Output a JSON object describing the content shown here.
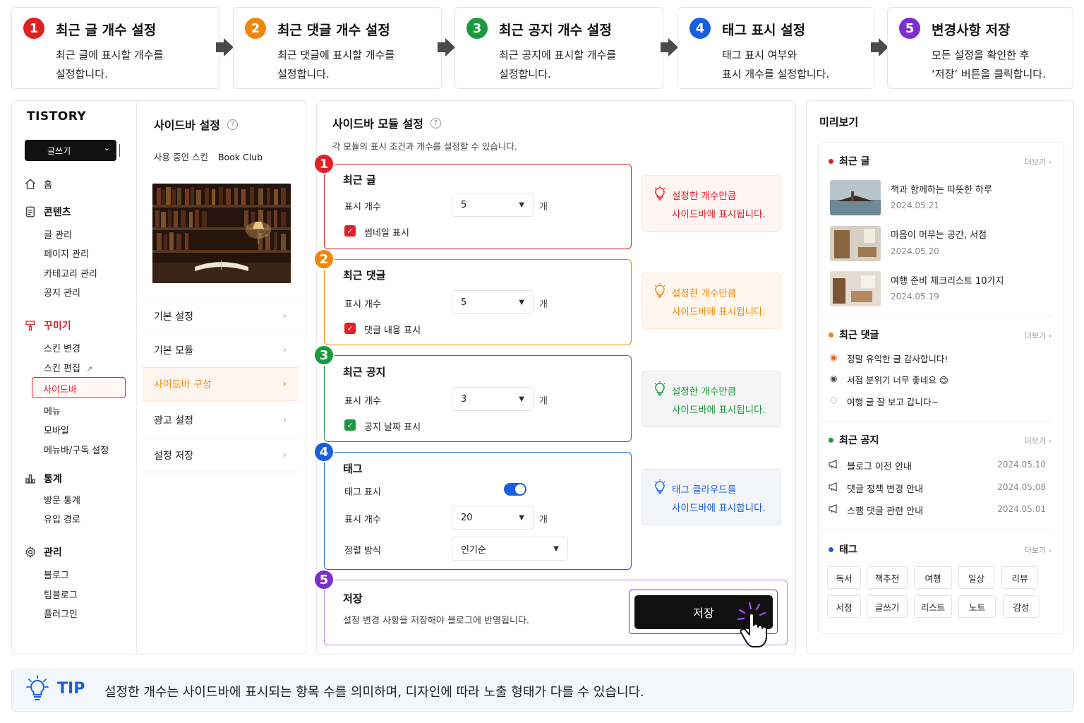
{
  "steps": [
    {
      "num": "1",
      "title": "최근 글 개수 설정",
      "desc1": "최근 글에 표시할 개수를",
      "desc2": "설정합니다.",
      "color": "#e02020"
    },
    {
      "num": "2",
      "title": "최근 댓글 개수 설정",
      "desc1": "최근 댓글에 표시할 개수를",
      "desc2": "설정합니다.",
      "color": "#f0860a"
    },
    {
      "num": "3",
      "title": "최근 공지 개수 설정",
      "desc1": "최근 공지에 표시할 개수를",
      "desc2": "설정합니다.",
      "color": "#1a9a3e"
    },
    {
      "num": "4",
      "title": "태그 표시 설정",
      "desc1": "태그 표시 여부와",
      "desc2": "표시 개수를 설정합니다.",
      "color": "#1a5fe0"
    },
    {
      "num": "5",
      "title": "변경사항 저장",
      "desc1": "모든 설정을 확인한 후",
      "desc2": "‘저장’ 버튼을 클릭합니다.",
      "color": "#7b2fd0"
    }
  ],
  "sidebar": {
    "logo": "TISTORY",
    "write": "글쓰기",
    "home": "홈",
    "content": "콘텐츠",
    "content_items": [
      "글 관리",
      "페이지 관리",
      "카테고리 관리",
      "공지 관리"
    ],
    "decorate": "꾸미기",
    "decorate_items": [
      "스킨 변경",
      "스킨 편집",
      "사이드바",
      "메뉴",
      "모바일",
      "메뉴바/구독 설정"
    ],
    "stats": "통계",
    "stats_items": [
      "방문 통계",
      "유입 경로"
    ],
    "manage": "관리",
    "manage_items": [
      "블로그",
      "팀블로그",
      "플러그인"
    ]
  },
  "settings": {
    "title": "사이드바 설정",
    "skin_label": "사용 중인 스킨",
    "skin_name": "Book Club",
    "menu": [
      "기본 설정",
      "기본 모듈",
      "사이드바 구성",
      "광고 설정",
      "설정 저장"
    ]
  },
  "modules": {
    "title": "사이드바 모듈 설정",
    "desc": "각 모듈의 표시 조건과 개수를 설정할 수 있습니다.",
    "count_label": "표시 개수",
    "unit": "개",
    "recent_posts": {
      "num": "1",
      "title": "최근 글",
      "count": "5",
      "check": "썸네일 표시"
    },
    "recent_comments": {
      "num": "2",
      "title": "최근 댓글",
      "count": "5",
      "check": "댓글 내용 표시"
    },
    "recent_notices": {
      "num": "3",
      "title": "최근 공지",
      "count": "3",
      "check": "공지 날짜 표시"
    },
    "tags": {
      "num": "4",
      "title": "태그",
      "show_label": "태그 표시",
      "count": "20",
      "sort_label": "정렬 방식",
      "sort": "인기순"
    },
    "save": {
      "num": "5",
      "title": "저장",
      "desc": "설정 변경 사항을 저장해야 블로그에 반영됩니다.",
      "button": "저장"
    }
  },
  "hints": [
    {
      "l1": "설정한 개수만큼",
      "l2": "사이드바에 표시됩니다.",
      "color": "#e0202a",
      "bg": "#fff5f3"
    },
    {
      "l1": "설정한 개수만큼",
      "l2": "사이드바에 표시됩니다.",
      "color": "#f0860a",
      "bg": "#fff7ee"
    },
    {
      "l1": "설정한 개수만큼",
      "l2": "사이드바에 표시됩니다.",
      "color": "#1a9a3e",
      "bg": "#f4f5f4"
    },
    {
      "l1": "태그 클라우드를",
      "l2": "사이드바에 표시합니다.",
      "color": "#1a5fe0",
      "bg": "#f3f5f9"
    }
  ],
  "preview": {
    "title": "미리보기",
    "more": "더보기",
    "posts_title": "최근 글",
    "posts": [
      {
        "title": "책과 함께하는 따뜻한 하루",
        "date": "2024.05.21"
      },
      {
        "title": "마음이 머무는 공간, 서점",
        "date": "2024.05.20"
      },
      {
        "title": "여행 준비 체크리스트 10가지",
        "date": "2024.05.19"
      }
    ],
    "comments_title": "최근 댓글",
    "comments": [
      "정말 유익한 글 감사합니다!",
      "서점 분위기 너무 좋네요 😊",
      "여행 글 잘 보고 갑니다~"
    ],
    "notices_title": "최근 공지",
    "notices": [
      {
        "title": "블로그 이전 안내",
        "date": "2024.05.10"
      },
      {
        "title": "댓글 정책 변경 안내",
        "date": "2024.05.08"
      },
      {
        "title": "스팸 댓글 관련 안내",
        "date": "2024.05.01"
      }
    ],
    "tags_title": "태그",
    "tags": [
      "독서",
      "책추천",
      "여행",
      "일상",
      "리뷰",
      "서점",
      "글쓰기",
      "리스트",
      "노트",
      "감성"
    ]
  },
  "tip": {
    "label": "TIP",
    "text": "설정한 개수는 사이드바에 표시되는 항목 수를 의미하며, 디자인에 따라 노출 형태가 다를 수 있습니다."
  }
}
